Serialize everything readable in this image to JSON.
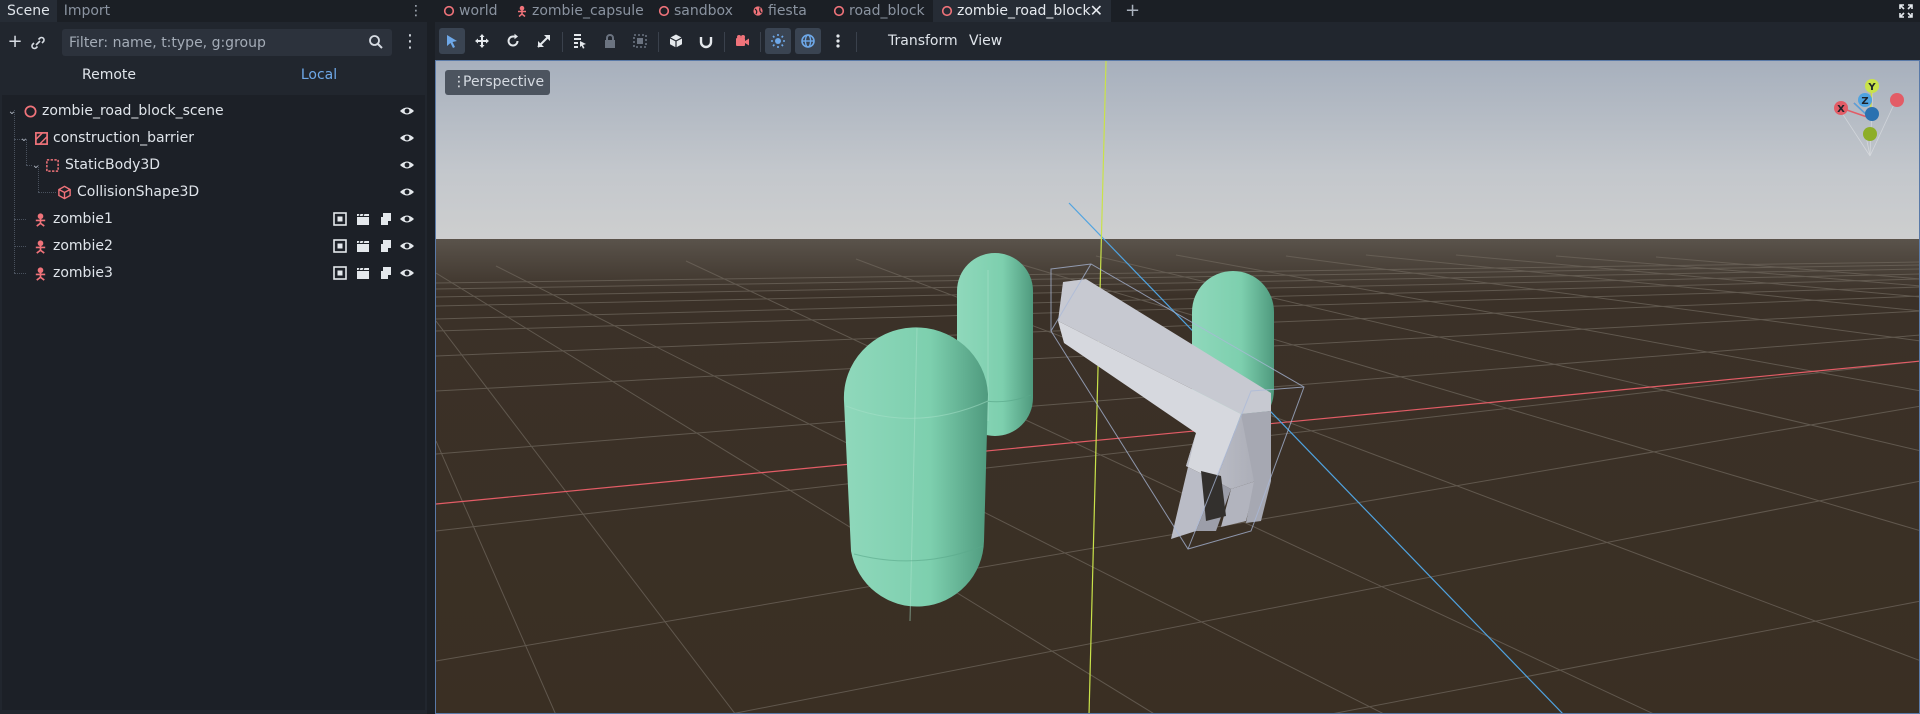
{
  "left_dock": {
    "tabs": [
      {
        "label": "Scene"
      },
      {
        "label": "Import"
      }
    ],
    "filter": {
      "placeholder": "Filter: name, t:type, g:group",
      "value": ""
    },
    "remote_label": "Remote",
    "local_label": "Local",
    "tree": [
      {
        "label": "zombie_road_block_scene",
        "icon": "node3d-icon",
        "expanded": true
      },
      {
        "label": "construction_barrier",
        "icon": "scene-instance-icon",
        "expanded": true
      },
      {
        "label": "StaticBody3D",
        "icon": "staticbody3d-icon",
        "expanded": true
      },
      {
        "label": "CollisionShape3D",
        "icon": "collisionshape3d-icon"
      },
      {
        "label": "zombie1",
        "icon": "zombie-instance-icon"
      },
      {
        "label": "zombie2",
        "icon": "zombie-instance-icon"
      },
      {
        "label": "zombie3",
        "icon": "zombie-instance-icon"
      }
    ]
  },
  "scene_tabs": [
    {
      "label": "world",
      "icon": "node3d-icon"
    },
    {
      "label": "zombie_capsule",
      "icon": "zombie-instance-icon"
    },
    {
      "label": "sandbox",
      "icon": "node3d-icon"
    },
    {
      "label": "fiesta",
      "icon": "globe-icon"
    },
    {
      "label": "road_block",
      "icon": "node3d-icon"
    },
    {
      "label": "zombie_road_block",
      "icon": "node3d-icon",
      "active": true
    }
  ],
  "toolbar": {
    "transform_menu": "Transform",
    "view_menu": "View"
  },
  "viewport": {
    "perspective_label": "Perspective",
    "gizmo_axes": {
      "x": "X",
      "y": "Y",
      "z": "Z"
    }
  },
  "colors": {
    "accent": "#6ea8e8",
    "node_icon": "#f0737a",
    "capsule": "#7fd3b0",
    "x_axis": "#e35c66",
    "y_axis": "#c9e24a",
    "z_axis": "#4fa3e0"
  }
}
